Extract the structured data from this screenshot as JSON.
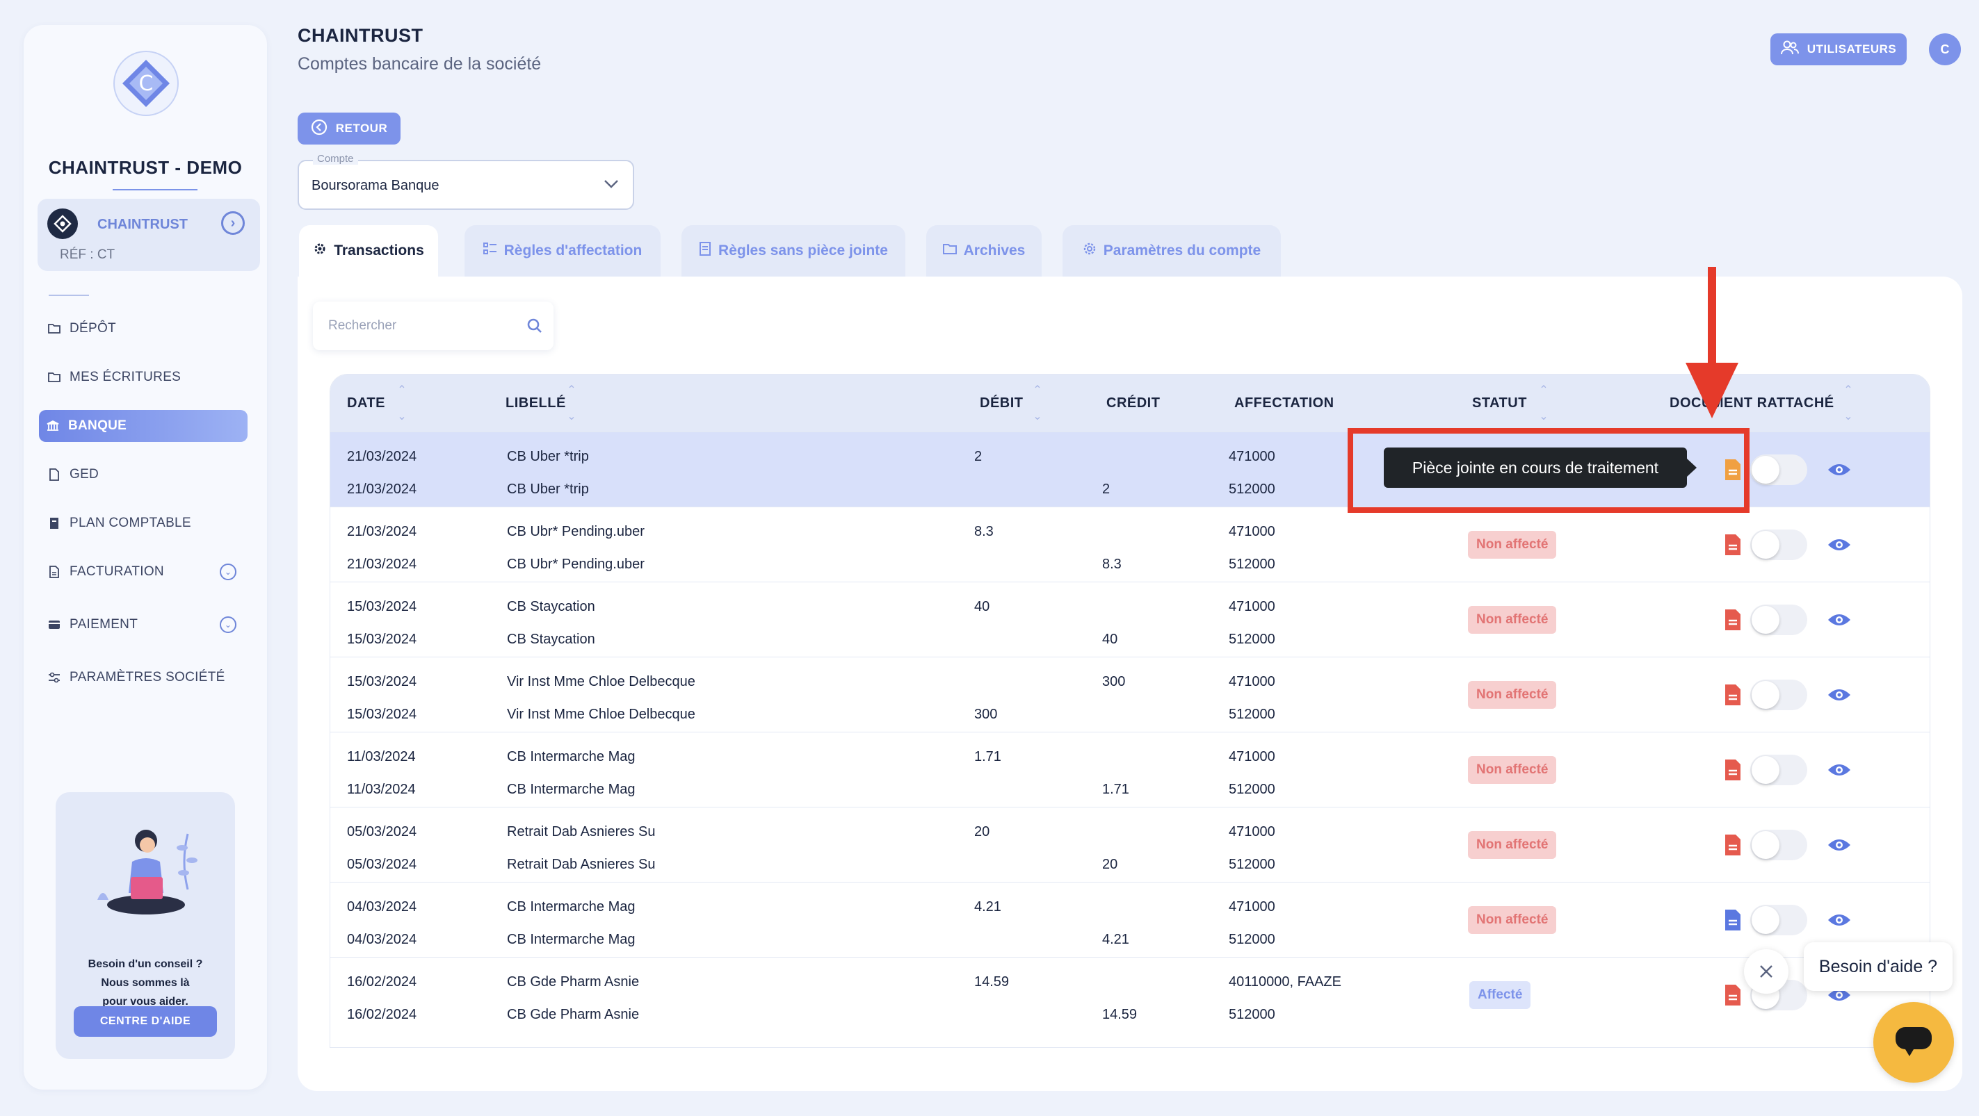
{
  "sidebar": {
    "company": "CHAINTRUST - DEMO",
    "org": {
      "name": "CHAINTRUST",
      "ref": "RÉF : CT"
    },
    "nav": [
      {
        "label": "DÉPÔT"
      },
      {
        "label": "MES ÉCRITURES"
      },
      {
        "label": "BANQUE"
      },
      {
        "label": "GED"
      },
      {
        "label": "PLAN COMPTABLE"
      },
      {
        "label": "FACTURATION"
      },
      {
        "label": "PAIEMENT"
      },
      {
        "label": "PARAMÈTRES SOCIÉTÉ"
      }
    ],
    "help": {
      "line1": "Besoin d'un conseil ?",
      "line2": "Nous sommes là",
      "line3": "pour vous aider.",
      "button": "CENTRE D'AIDE"
    }
  },
  "header": {
    "title": "CHAINTRUST",
    "subtitle": "Comptes bancaire de la société",
    "users_button": "UTILISATEURS",
    "avatar_initial": "C"
  },
  "back_button": "RETOUR",
  "account": {
    "label": "Compte",
    "value": "Boursorama Banque"
  },
  "tabs": [
    {
      "label": "Transactions"
    },
    {
      "label": "Règles d'affectation"
    },
    {
      "label": "Règles sans pièce jointe"
    },
    {
      "label": "Archives"
    },
    {
      "label": "Paramètres du compte"
    }
  ],
  "search": {
    "placeholder": "Rechercher"
  },
  "table": {
    "columns": [
      "DATE",
      "LIBELLÉ",
      "DÉBIT",
      "CRÉDIT",
      "AFFECTATION",
      "STATUT",
      "DOCUMENT RATTACHÉ"
    ],
    "rows": [
      {
        "date1": "21/03/2024",
        "date2": "21/03/2024",
        "lib1": "CB Uber *trip",
        "lib2": "CB Uber *trip",
        "debit": "2",
        "credit": "2",
        "aff1": "471000",
        "aff2": "512000",
        "status": "",
        "doc_color": "#f0a042"
      },
      {
        "date1": "21/03/2024",
        "date2": "21/03/2024",
        "lib1": "CB Ubr* Pending.uber",
        "lib2": "CB Ubr* Pending.uber",
        "debit": "8.3",
        "credit": "8.3",
        "aff1": "471000",
        "aff2": "512000",
        "status": "Non affecté",
        "doc_color": "#e55a4e"
      },
      {
        "date1": "15/03/2024",
        "date2": "15/03/2024",
        "lib1": "CB Staycation",
        "lib2": "CB Staycation",
        "debit": "40",
        "credit": "40",
        "aff1": "471000",
        "aff2": "512000",
        "status": "Non affecté",
        "doc_color": "#e55a4e"
      },
      {
        "date1": "15/03/2024",
        "date2": "15/03/2024",
        "lib1": "Vir Inst Mme Chloe Delbecque",
        "lib2": "Vir Inst Mme Chloe Delbecque",
        "debit": "300",
        "credit": "300",
        "aff1": "471000",
        "aff2": "512000",
        "status": "Non affecté",
        "doc_color": "#e55a4e",
        "swap": true
      },
      {
        "date1": "11/03/2024",
        "date2": "11/03/2024",
        "lib1": "CB Intermarche Mag",
        "lib2": "CB Intermarche Mag",
        "debit": "1.71",
        "credit": "1.71",
        "aff1": "471000",
        "aff2": "512000",
        "status": "Non affecté",
        "doc_color": "#e55a4e"
      },
      {
        "date1": "05/03/2024",
        "date2": "05/03/2024",
        "lib1": "Retrait Dab Asnieres Su",
        "lib2": "Retrait Dab Asnieres Su",
        "debit": "20",
        "credit": "20",
        "aff1": "471000",
        "aff2": "512000",
        "status": "Non affecté",
        "doc_color": "#e55a4e"
      },
      {
        "date1": "04/03/2024",
        "date2": "04/03/2024",
        "lib1": "CB Intermarche Mag",
        "lib2": "CB Intermarche Mag",
        "debit": "4.21",
        "credit": "4.21",
        "aff1": "471000",
        "aff2": "512000",
        "status": "Non affecté",
        "doc_color": "#5b78e0"
      },
      {
        "date1": "16/02/2024",
        "date2": "16/02/2024",
        "lib1": "CB Gde Pharm Asnie",
        "lib2": "CB Gde Pharm Asnie",
        "debit": "14.59",
        "credit": "14.59",
        "aff1": "40110000, FAAZE",
        "aff2": "512000",
        "status": "Affecté",
        "doc_color": "#e55a4e"
      }
    ]
  },
  "tooltip": "Pièce jointe en cours de traitement",
  "chat": {
    "bubble": "Besoin d'aide ?"
  },
  "colors": {
    "accent": "#7d93ea",
    "annotation": "#e53a2a",
    "chat": "#f5b940"
  }
}
